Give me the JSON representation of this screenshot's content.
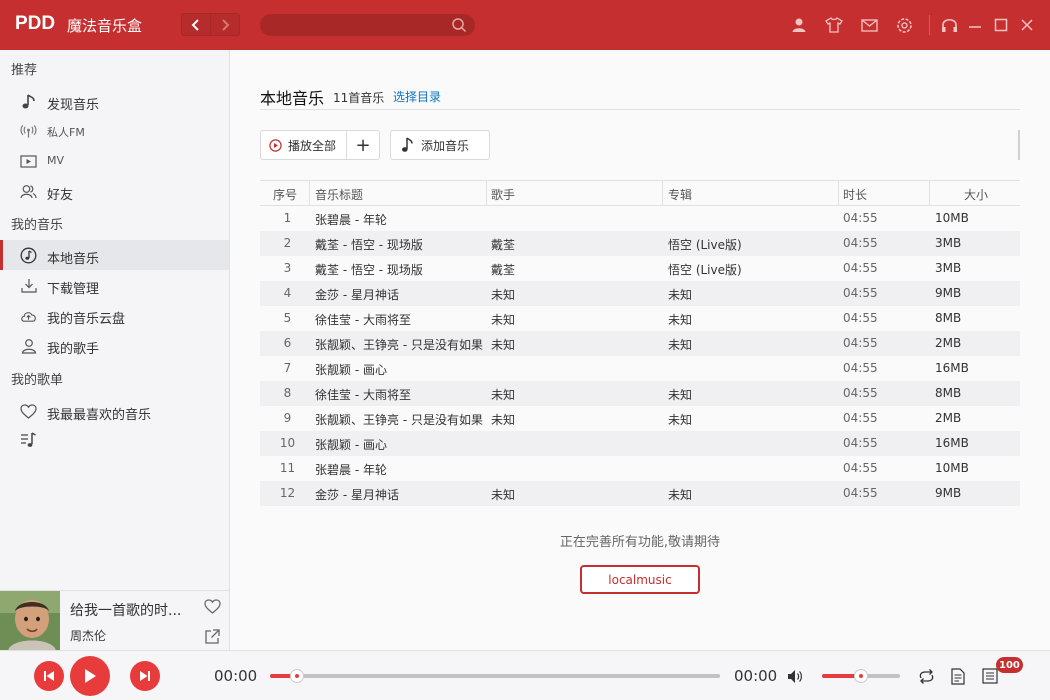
{
  "app": {
    "logo": "PDD",
    "name": "魔法音乐盒"
  },
  "search": {
    "placeholder": "",
    "value": ""
  },
  "colors": {
    "brand": "#c62f2f",
    "accent": "#e83c3c",
    "link": "#0c73c2"
  },
  "toolbar_icons": [
    "user-icon",
    "skin-icon",
    "mail-icon",
    "settings-icon",
    "mini-mode-icon",
    "minimize-icon",
    "maximize-icon",
    "close-icon"
  ],
  "sidebar": {
    "sections": [
      {
        "title": "推荐",
        "items": [
          {
            "label": "发现音乐",
            "icon": "music-note-icon"
          },
          {
            "label": "私人FM",
            "icon": "radio-icon"
          },
          {
            "label": "MV",
            "icon": "video-icon"
          },
          {
            "label": "好友",
            "icon": "friends-icon"
          }
        ]
      },
      {
        "title": "我的音乐",
        "items": [
          {
            "label": "本地音乐",
            "icon": "local-music-icon",
            "active": true
          },
          {
            "label": "下载管理",
            "icon": "download-icon"
          },
          {
            "label": "我的音乐云盘",
            "icon": "cloud-icon"
          },
          {
            "label": "我的歌手",
            "icon": "singer-icon"
          }
        ]
      },
      {
        "title": "我的歌单",
        "items": [
          {
            "label": "我最最喜欢的音乐",
            "icon": "heart-icon"
          },
          {
            "label": "",
            "icon": "playlist-icon"
          }
        ]
      }
    ]
  },
  "now_playing": {
    "title": "给我一首歌的时...",
    "artist": "周杰伦"
  },
  "page": {
    "title": "本地音乐",
    "count": "11首音乐",
    "choose_dir": "选择目录",
    "play_all": "播放全部",
    "add_label": "+",
    "add_music": "添加音乐",
    "columns": [
      "序号",
      "音乐标题",
      "歌手",
      "专辑",
      "时长",
      "大小"
    ],
    "songs": [
      {
        "no": "1",
        "title": "张碧晨 - 年轮",
        "artist": "",
        "album": "",
        "duration": "04:55",
        "size": "10MB"
      },
      {
        "no": "2",
        "title": "戴荃 - 悟空 - 现场版",
        "artist": "戴荃",
        "album": "悟空 (Live版)",
        "duration": "04:55",
        "size": "3MB"
      },
      {
        "no": "3",
        "title": "戴荃 - 悟空 - 现场版",
        "artist": "戴荃",
        "album": "悟空 (Live版)",
        "duration": "04:55",
        "size": "3MB"
      },
      {
        "no": "4",
        "title": "金莎 - 星月神话",
        "artist": "未知",
        "album": "未知",
        "duration": "04:55",
        "size": "9MB"
      },
      {
        "no": "5",
        "title": "徐佳莹 - 大雨将至",
        "artist": "未知",
        "album": "未知",
        "duration": "04:55",
        "size": "8MB"
      },
      {
        "no": "6",
        "title": "张靓颖、王铮亮 - 只是没有如果",
        "artist": "未知",
        "album": "未知",
        "duration": "04:55",
        "size": "2MB"
      },
      {
        "no": "7",
        "title": "张靓颖 - 画心",
        "artist": "",
        "album": "",
        "duration": "04:55",
        "size": "16MB"
      },
      {
        "no": "8",
        "title": "徐佳莹 - 大雨将至",
        "artist": "未知",
        "album": "未知",
        "duration": "04:55",
        "size": "8MB"
      },
      {
        "no": "9",
        "title": "张靓颖、王铮亮 - 只是没有如果",
        "artist": "未知",
        "album": "未知",
        "duration": "04:55",
        "size": "2MB"
      },
      {
        "no": "10",
        "title": "张靓颖 - 画心",
        "artist": "",
        "album": "",
        "duration": "04:55",
        "size": "16MB"
      },
      {
        "no": "11",
        "title": "张碧晨 - 年轮",
        "artist": "",
        "album": "",
        "duration": "04:55",
        "size": "10MB"
      },
      {
        "no": "12",
        "title": "金莎 - 星月神话",
        "artist": "未知",
        "album": "未知",
        "duration": "04:55",
        "size": "9MB"
      }
    ],
    "wip_message": "正在完善所有功能,敬请期待",
    "local_button": "localmusic"
  },
  "player": {
    "current_time": "00:00",
    "total_time": "00:00",
    "progress": 0.06,
    "volume": 0.5,
    "playlist_count": "100"
  }
}
